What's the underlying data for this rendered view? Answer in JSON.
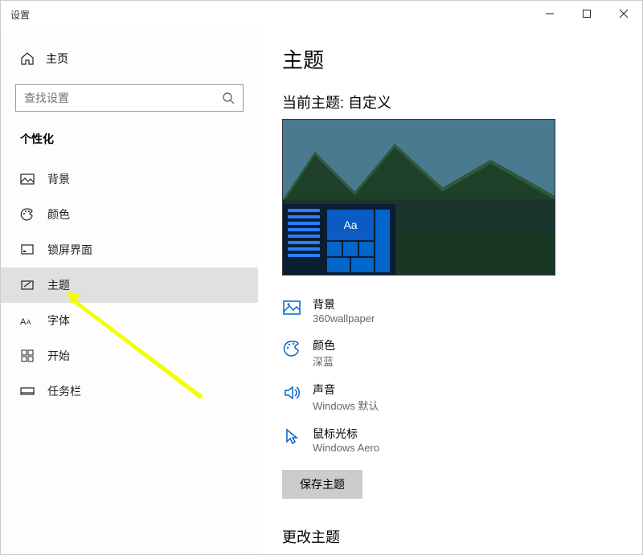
{
  "window": {
    "title": "设置"
  },
  "sidebar": {
    "home": "主页",
    "search_placeholder": "查找设置",
    "section": "个性化",
    "items": [
      {
        "label": "背景"
      },
      {
        "label": "颜色"
      },
      {
        "label": "锁屏界面"
      },
      {
        "label": "主题"
      },
      {
        "label": "字体"
      },
      {
        "label": "开始"
      },
      {
        "label": "任务栏"
      }
    ]
  },
  "main": {
    "page_title": "主题",
    "current_theme_label": "当前主题: 自定义",
    "preview_sample": "Aa",
    "cards": {
      "background": {
        "label": "背景",
        "value": "360wallpaper"
      },
      "color": {
        "label": "颜色",
        "value": "深蓝"
      },
      "sound": {
        "label": "声音",
        "value": "Windows 默认"
      },
      "cursor": {
        "label": "鼠标光标",
        "value": "Windows Aero"
      }
    },
    "save_btn": "保存主题",
    "change_theme": "更改主题"
  }
}
